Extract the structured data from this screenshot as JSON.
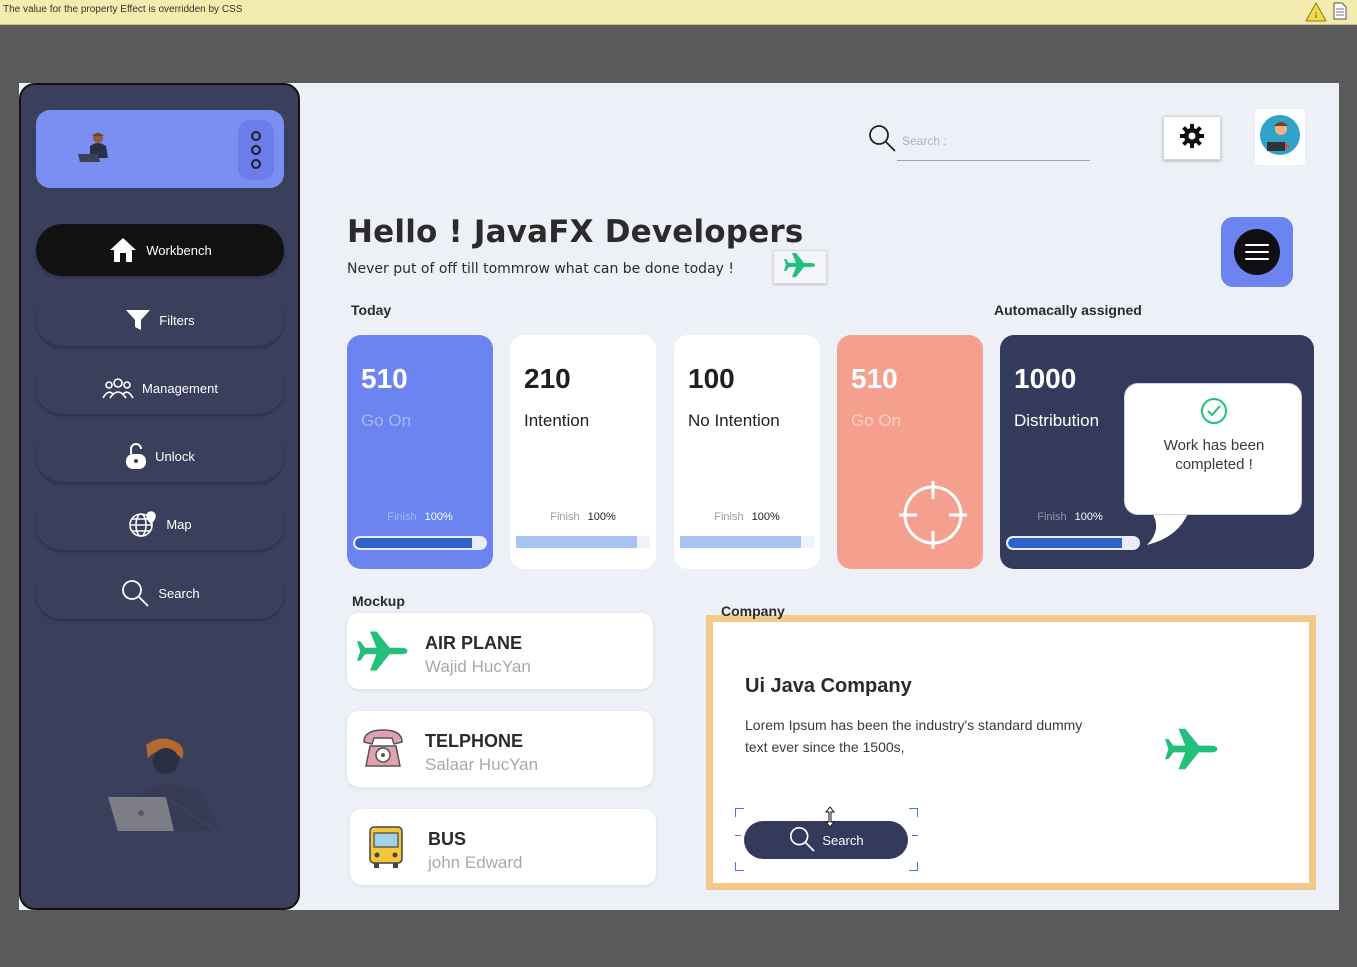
{
  "warning_bar": {
    "message": "The value for the property Effect is overridden by CSS",
    "icons": [
      "warning-icon",
      "document-icon"
    ]
  },
  "sidebar": {
    "profile_icons": [
      "developer-avatar-icon",
      "vertical-dots-icon"
    ],
    "items": [
      {
        "label": "Workbench",
        "icon": "home-icon",
        "active": true
      },
      {
        "label": "Filters",
        "icon": "filter-icon",
        "active": false
      },
      {
        "label": "Management",
        "icon": "group-icon",
        "active": false
      },
      {
        "label": "Unlock",
        "icon": "unlock-icon",
        "active": false
      },
      {
        "label": "Map",
        "icon": "globe-pin-icon",
        "active": false
      },
      {
        "label": "Search",
        "icon": "search-icon",
        "active": false
      }
    ]
  },
  "header": {
    "search_placeholder": "Search :",
    "settings_icon": "gear-icon",
    "avatar_icon": "user-avatar-icon"
  },
  "hero": {
    "title": "Hello ! JavaFX Developers",
    "motto": "Never put of off till tommrow what can be done today !"
  },
  "today": {
    "label": "Today",
    "cards": [
      {
        "number": "510",
        "label": "Go On",
        "finish_label": "Finish",
        "percent": "100%",
        "progress": 0.9
      },
      {
        "number": "210",
        "label": "Intention",
        "finish_label": "Finish",
        "percent": "100%",
        "progress": 0.9
      },
      {
        "number": "100",
        "label": "No Intention",
        "finish_label": "Finish",
        "percent": "100%",
        "progress": 0.9
      },
      {
        "number": "510",
        "label": "Go On"
      }
    ]
  },
  "assigned": {
    "label": "Automacally assigned",
    "number": "1000",
    "text": "Distribution",
    "finish_label": "Finish",
    "percent": "100%",
    "progress": 0.88,
    "bubble_text": "Work has been completed !"
  },
  "mockup": {
    "label": "Mockup",
    "items": [
      {
        "title": "AIR PLANE",
        "subtitle": "Wajid HucYan",
        "icon": "airplane-icon"
      },
      {
        "title": "TELPHONE",
        "subtitle": "Salaar HucYan",
        "icon": "telephone-icon"
      },
      {
        "title": "BUS",
        "subtitle": "john Edward",
        "icon": "bus-icon"
      }
    ]
  },
  "company": {
    "label": "Company",
    "title": "Ui Java Company",
    "text": "Lorem Ipsum has been the industry's standard dummy text ever since the 1500s,",
    "button_label": "Search"
  },
  "colors": {
    "accent_blue": "#6b84f0",
    "navy": "#343a5b",
    "salmon": "#f5a08f",
    "green": "#22c07a",
    "highlight_border": "#f0c98b"
  }
}
